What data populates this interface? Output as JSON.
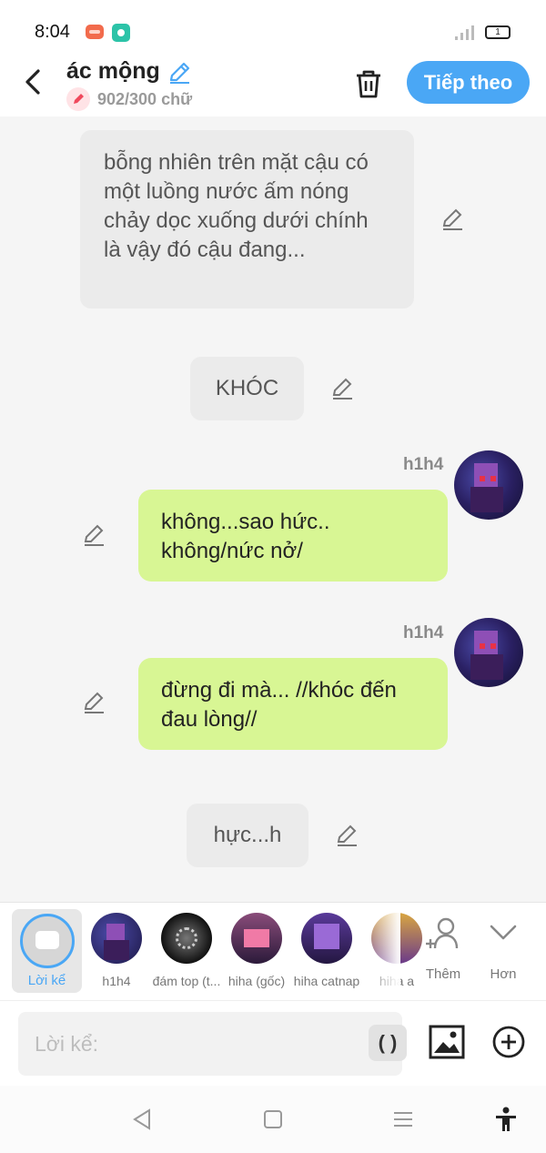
{
  "status": {
    "time": "8:04",
    "battery": "1"
  },
  "header": {
    "title": "ác mộng",
    "word_count": "902/300 chữ",
    "next_label": "Tiếp theo"
  },
  "messages": [
    {
      "type": "narration",
      "text": "bỗng nhiên trên mặt cậu có một luồng nước ấm nóng chảy dọc xuống dưới chính là vậy đó cậu đang..."
    },
    {
      "type": "narration",
      "text": "KHÓC"
    },
    {
      "type": "character",
      "sender": "h1h4",
      "text": "không...sao hức.. không/nức nở/"
    },
    {
      "type": "character",
      "sender": "h1h4",
      "text": "đừng đi mà... //khóc đến đau lòng//"
    },
    {
      "type": "narration",
      "text": "hực...h"
    }
  ],
  "characters": [
    {
      "label": "Lời kể",
      "selected": true
    },
    {
      "label": "h1h4"
    },
    {
      "label": "đám top (t..."
    },
    {
      "label": "hiha (gốc)"
    },
    {
      "label": "hiha catnap"
    },
    {
      "label": "hiha a"
    }
  ],
  "actions": {
    "add_label": "Thêm",
    "more_label": "Hơn"
  },
  "input": {
    "placeholder": "Lời kể:",
    "paren_label": "( )"
  },
  "colors": {
    "accent": "#4aa7f5",
    "character_bubble": "#d8f694",
    "narration_bubble": "#ebebeb"
  }
}
